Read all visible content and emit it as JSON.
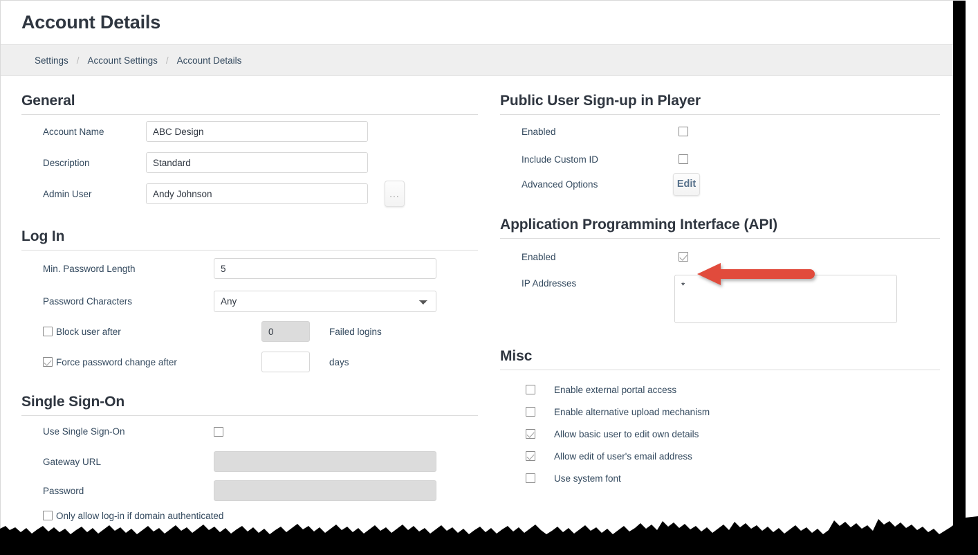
{
  "header": {
    "title": "Account Details",
    "breadcrumb": [
      "Settings",
      "Account Settings",
      "Account Details"
    ],
    "separator": "/"
  },
  "general": {
    "title": "General",
    "account_name_label": "Account Name",
    "account_name_value": "ABC Design",
    "description_label": "Description",
    "description_value": "Standard",
    "admin_user_label": "Admin User",
    "admin_user_value": "Andy Johnson",
    "browse_button_label": "..."
  },
  "login": {
    "title": "Log In",
    "min_password_length_label": "Min. Password Length",
    "min_password_length_value": "5",
    "password_characters_label": "Password Characters",
    "password_characters_value": "Any",
    "password_characters_options": [
      "Any"
    ],
    "block_user_label": "Block user after",
    "block_user_checked": false,
    "block_user_value": "0",
    "failed_logins_label": "Failed logins",
    "force_change_label": "Force password change after",
    "force_change_checked": true,
    "force_change_value": "",
    "days_label": "days"
  },
  "sso": {
    "title": "Single Sign-On",
    "use_sso_label": "Use Single Sign-On",
    "use_sso_checked": false,
    "gateway_url_label": "Gateway URL",
    "gateway_url_value": "",
    "password_label": "Password",
    "password_value": "",
    "domain_auth_label": "Only allow log-in if domain authenticated",
    "domain_auth_checked": false
  },
  "signup": {
    "title": "Public User Sign-up in Player",
    "enabled_label": "Enabled",
    "enabled_checked": false,
    "custom_id_label": "Include Custom ID",
    "custom_id_checked": false,
    "advanced_options_label": "Advanced Options",
    "edit_button_label": "Edit"
  },
  "api": {
    "title": "Application Programming Interface (API)",
    "enabled_label": "Enabled",
    "enabled_checked": true,
    "ip_addresses_label": "IP Addresses",
    "ip_addresses_value": "*"
  },
  "misc": {
    "title": "Misc",
    "items": [
      {
        "label": "Enable external portal access",
        "checked": false
      },
      {
        "label": "Enable alternative upload mechanism",
        "checked": false
      },
      {
        "label": "Allow basic user to edit own details",
        "checked": true
      },
      {
        "label": "Allow edit of user's email address",
        "checked": true
      },
      {
        "label": "Use system font",
        "checked": false
      }
    ]
  },
  "annotation": {
    "arrow_color": "#e14b3c",
    "arrow_direction": "left"
  },
  "colors": {
    "accent": "#e14b3c",
    "text": "#33495e",
    "heading": "#2f3640",
    "breadcrumb_bg": "#efefef",
    "disabled_field": "#dcdcdc"
  }
}
